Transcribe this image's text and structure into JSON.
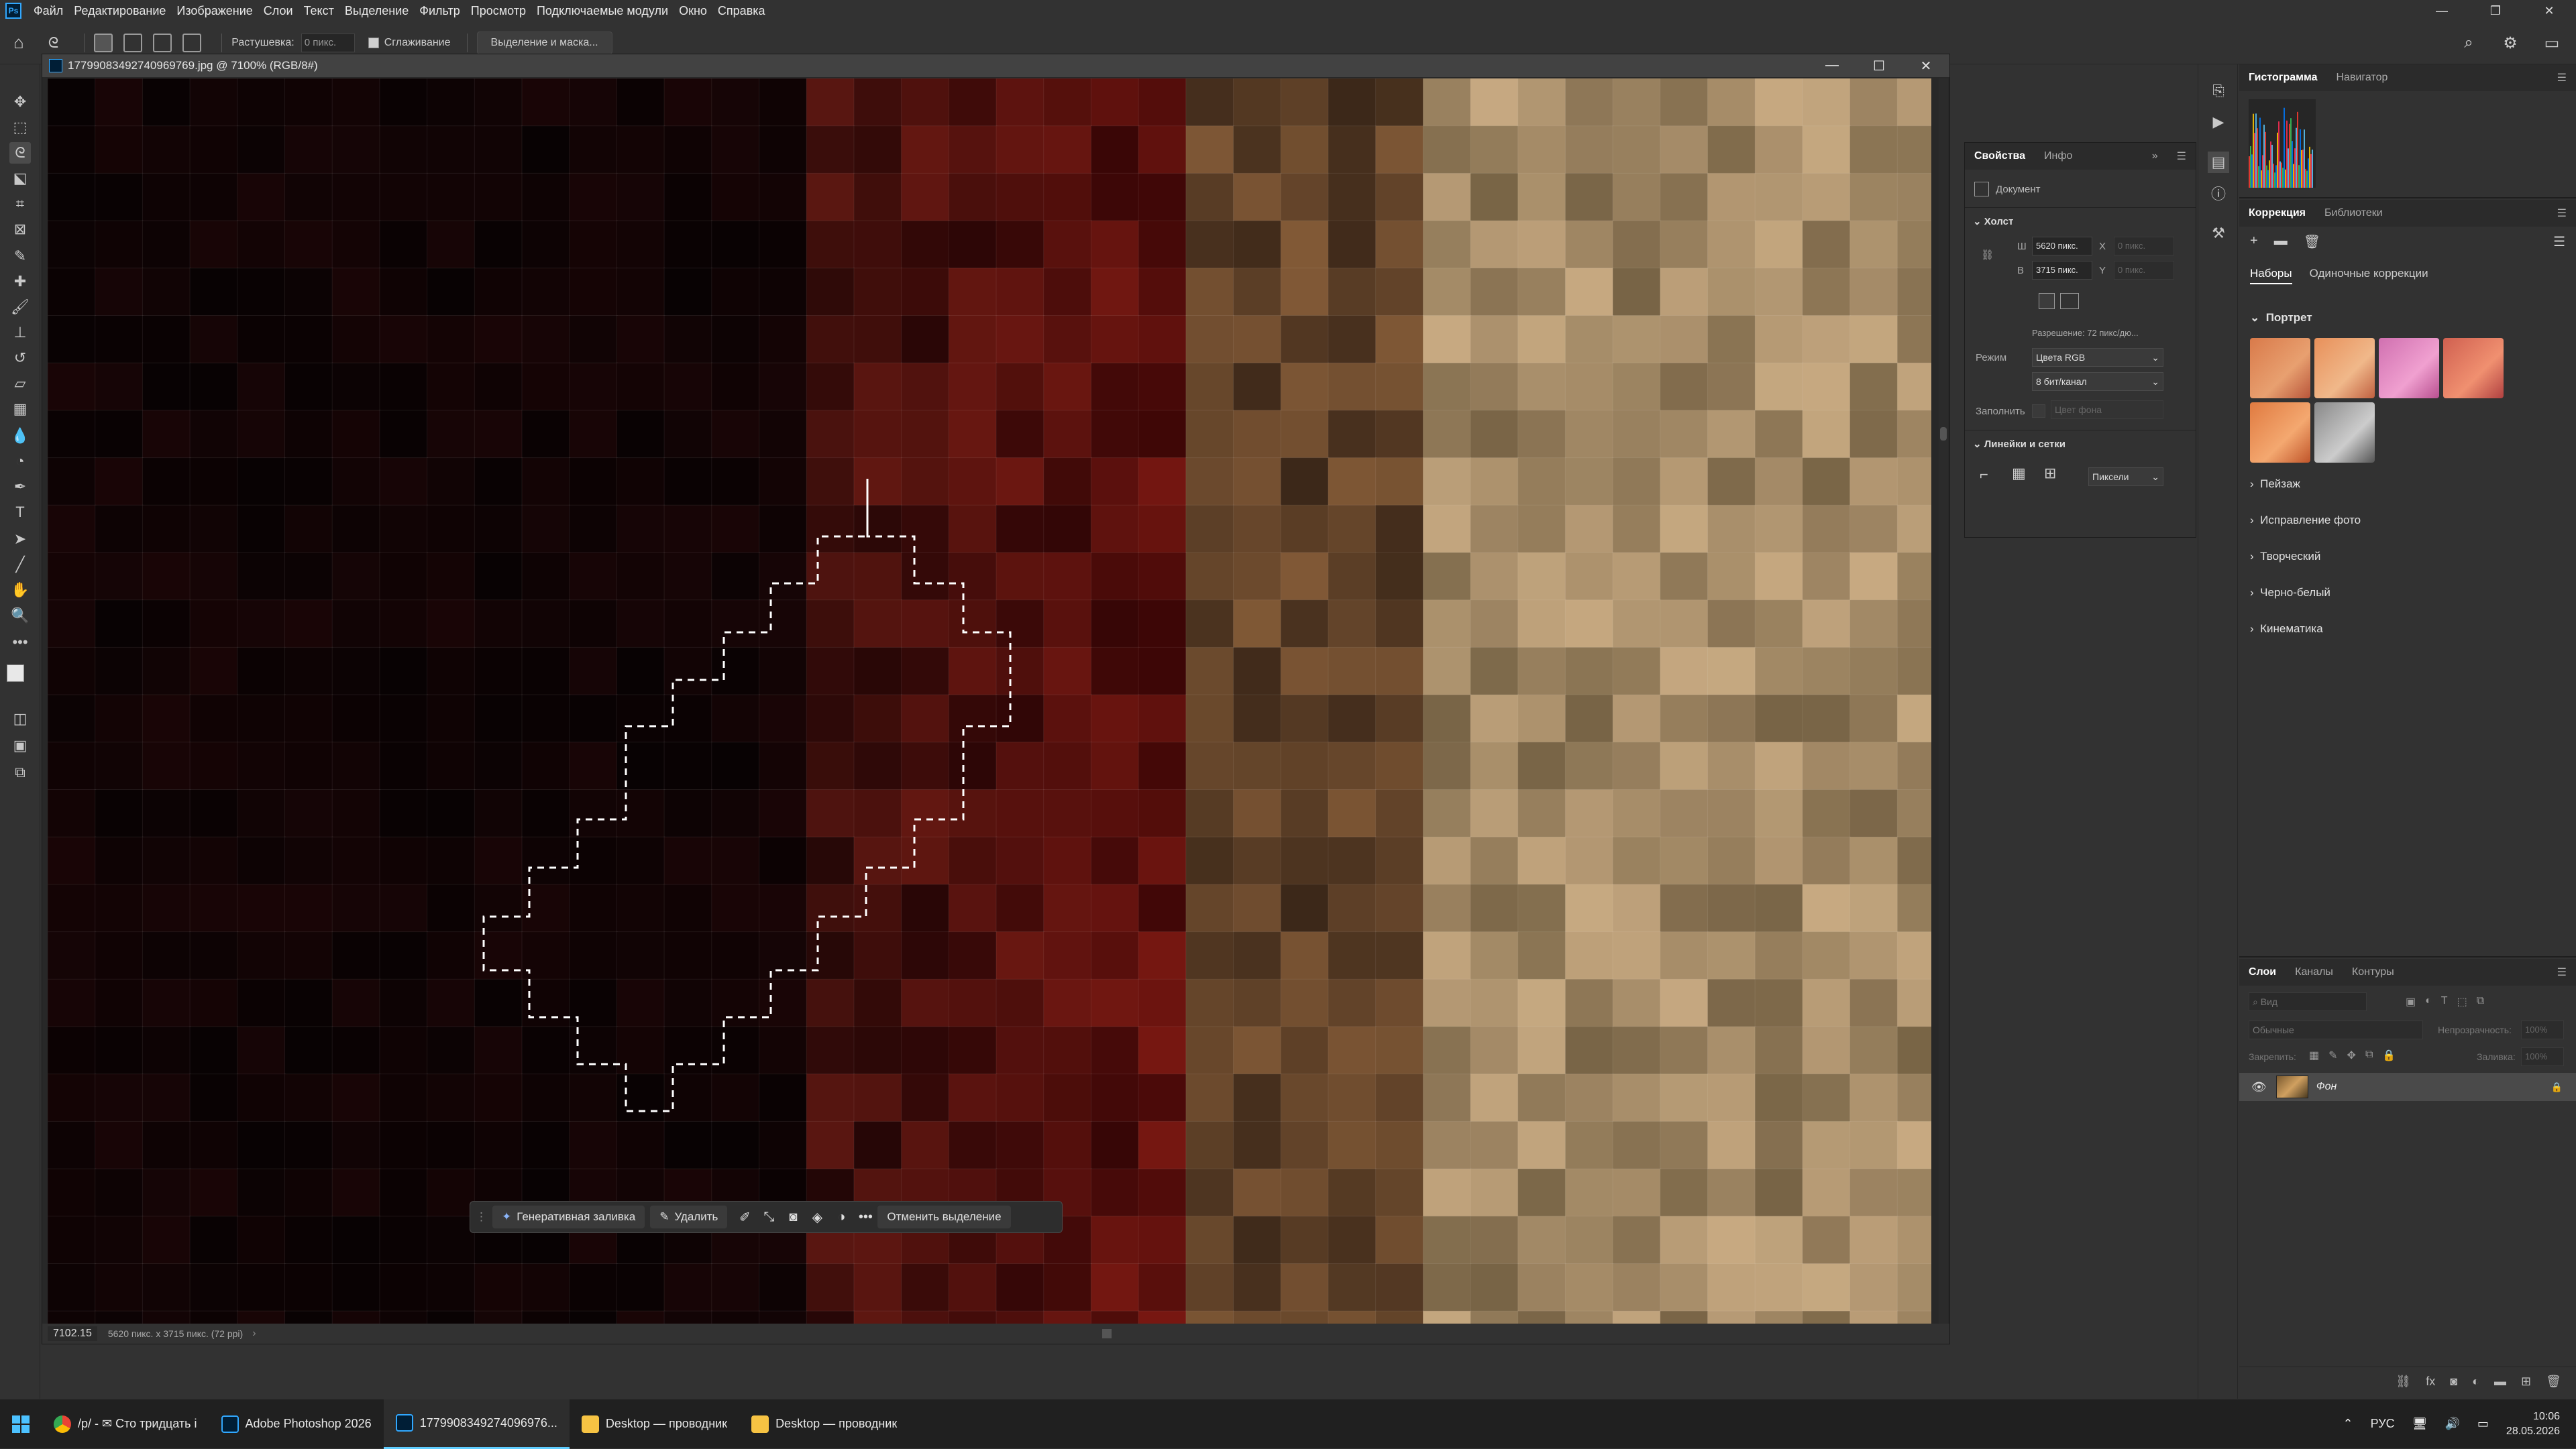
{
  "menubar": {
    "items": [
      "Файл",
      "Редактирование",
      "Изображение",
      "Слои",
      "Текст",
      "Выделение",
      "Фильтр",
      "Просмотр",
      "Подключаемые модули",
      "Окно",
      "Справка"
    ],
    "window_controls": [
      "—",
      "❐",
      "✕"
    ]
  },
  "options": {
    "feather_label": "Растушевка:",
    "feather_value": "0 пикс.",
    "antialias_label": "Сглаживание",
    "select_mask_label": "Выделение и маска..."
  },
  "document": {
    "title": "1779908349274096976​9.jpg @ 7100% (RGB/8#)",
    "zoom": "7102.15",
    "info": "5620 пикс. x 3715 пикс. (72 ppi)",
    "controls": [
      "—",
      "☐",
      "✕"
    ]
  },
  "contextbar": {
    "gen_fill": "Генеративная заливка",
    "delete": "Удалить",
    "deselect": "Отменить выделение"
  },
  "properties": {
    "tabs": [
      "Свойства",
      "Инфо"
    ],
    "doc_label": "Документ",
    "canvas_section": "Холст",
    "w_label": "Ш",
    "w_value": "5620 пикс.",
    "x_label": "X",
    "x_placeholder": "0 пикс.",
    "h_label": "В",
    "h_value": "3715 пикс.",
    "y_label": "Y",
    "y_placeholder": "0 пикс.",
    "resolution": "Разрешение: 72 пикс/дю...",
    "mode_label": "Режим",
    "mode_value": "Цвета RGB",
    "depth_value": "8 бит/канал",
    "fill_label": "Заполнить",
    "fill_value": "Цвет фона",
    "rulers_section": "Линейки и сетки",
    "units_value": "Пиксели"
  },
  "histogram": {
    "tabs": [
      "Гистограмма",
      "Навигатор"
    ]
  },
  "adjustments": {
    "tabs": [
      "Коррекция",
      "Библиотеки"
    ],
    "subtabs": [
      "Наборы",
      "Одиночные коррекции"
    ],
    "groups": [
      "Портрет",
      "Пейзаж",
      "Исправление фото",
      "Творческий",
      "Черно-белый",
      "Кинематика"
    ]
  },
  "layers": {
    "tabs": [
      "Слои",
      "Каналы",
      "Контуры"
    ],
    "search_placeholder": "Вид",
    "blend_mode": "Обычные",
    "opacity_label": "Непрозрачность:",
    "opacity_value": "100%",
    "lock_label": "Закрепить:",
    "fill_label": "Заливка:",
    "fill_value": "100%",
    "layer_name": "Фон"
  },
  "taskbar": {
    "apps": [
      "/p/ - ✉ Сто тридцать і",
      "Adobe Photoshop 2026",
      "1779908349274096976...",
      "Desktop — проводник",
      "Desktop — проводник"
    ],
    "lang": "РУС",
    "time": "10:06",
    "date": "28.05.2026"
  },
  "colors": {
    "accent": "#31a8ff",
    "bg": "#323232",
    "canvas_bg": "#000000"
  }
}
